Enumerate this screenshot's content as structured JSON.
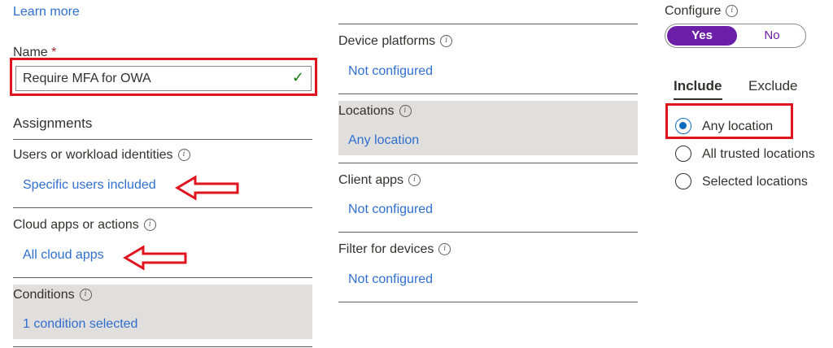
{
  "top": {
    "learn_more": "Learn more"
  },
  "name_field": {
    "label": "Name",
    "required_mark": "*",
    "value": "Require MFA for OWA",
    "check": "✓"
  },
  "assignments": {
    "title": "Assignments",
    "users": {
      "label": "Users or workload identities",
      "value": "Specific users included"
    },
    "cloud_apps": {
      "label": "Cloud apps or actions",
      "value": "All cloud apps"
    },
    "conditions": {
      "label": "Conditions",
      "value": "1 condition selected"
    }
  },
  "middle": {
    "device_platforms": {
      "label": "Device platforms",
      "value": "Not configured"
    },
    "locations": {
      "label": "Locations",
      "value": "Any location"
    },
    "client_apps": {
      "label": "Client apps",
      "value": "Not configured"
    },
    "filter_devices": {
      "label": "Filter for devices",
      "value": "Not configured"
    }
  },
  "configure": {
    "label": "Configure",
    "yes": "Yes",
    "no": "No",
    "selected": "Yes"
  },
  "tabs": {
    "include": "Include",
    "exclude": "Exclude",
    "active": "Include"
  },
  "location_options": [
    {
      "label": "Any location",
      "checked": true
    },
    {
      "label": "All trusted locations",
      "checked": false
    },
    {
      "label": "Selected locations",
      "checked": false
    }
  ],
  "info_glyph": "i",
  "colors": {
    "accent": "#6b1fa6",
    "link": "#2f6fd0",
    "highlight": "#e0141e",
    "radio": "#0f6cbd"
  }
}
